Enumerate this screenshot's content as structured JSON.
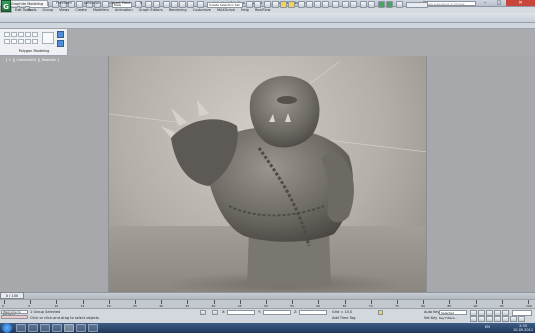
{
  "window": {
    "title": "Autodesk 3ds Max 2012 x64    Troll_Render_Marble.max",
    "search_placeholder": "Type a keyword or phrase",
    "app_logo": "G",
    "controls": {
      "minimize": "–",
      "maximize": "□",
      "close": "✕"
    }
  },
  "menu": {
    "items": [
      "Edit",
      "Tools",
      "Group",
      "Views",
      "Create",
      "Modifiers",
      "Animation",
      "Graph Editors",
      "Rendering",
      "Customize",
      "MAXScript",
      "Help",
      "RealFlow"
    ]
  },
  "toolbar": {
    "undo_icon": "undo-icon",
    "selection_filter": "All",
    "ref_coord": "View",
    "named_selection": "Create Selection Set"
  },
  "ribbon": {
    "tabs": [
      "Graphite Modeling Tools",
      "Freeform",
      "Selection",
      "Object Paint"
    ],
    "active_tab": "Graphite Modeling Tools",
    "panel_caption": "Polygon Modeling"
  },
  "viewport": {
    "label": "[ + ][ Camera001 ][ Realistic ]"
  },
  "timeline": {
    "frame_display": "0 / 100",
    "ticks": [
      "0",
      "5",
      "10",
      "15",
      "20",
      "25",
      "30",
      "35",
      "40",
      "45",
      "50",
      "55",
      "60",
      "65",
      "70",
      "75",
      "80",
      "85",
      "90",
      "95",
      "100"
    ]
  },
  "status": {
    "maxscript_label": "Welcome to MAXScri",
    "selection": "1 Group Selected",
    "prompt": "Click or click-and-drag to select objects",
    "coord_labels": [
      "X:",
      "Y:",
      "Z:"
    ],
    "grid": "Grid = 10,0",
    "auto_key": "Auto Key",
    "set_key": "Set Key",
    "selected_dropdown": "Selected",
    "key_filters": "Key Filters...",
    "add_time_tag": "Add Time Tag"
  },
  "taskbar": {
    "time": "2:33",
    "date": "10.05.2011",
    "tray": "EN"
  }
}
